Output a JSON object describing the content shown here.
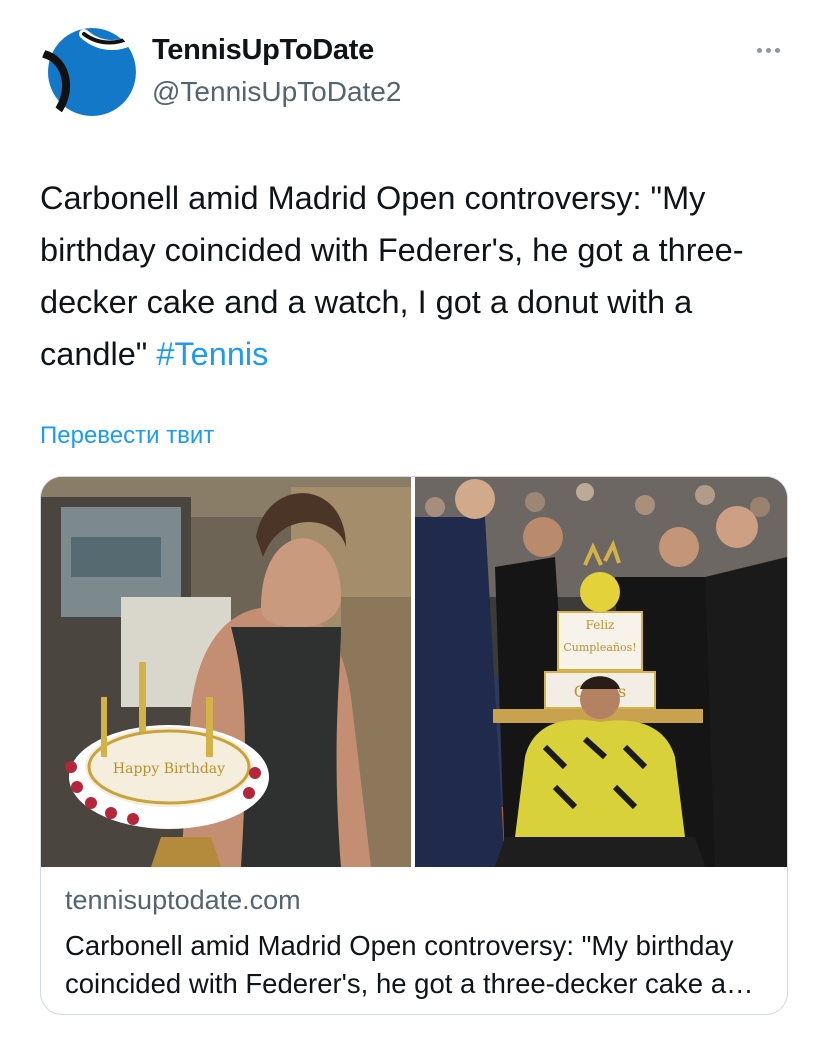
{
  "tweet": {
    "author": {
      "display_name": "TennisUpToDate",
      "handle": "@TennisUpToDate2",
      "avatar_icon": "tennis-ball-logo-icon"
    },
    "more_icon": "more-horizontal-icon",
    "text_main": "Carbonell amid Madrid Open controversy: \"My birthday coincided with Federer's, he got a three-decker cake and a watch, I got a donut with a candle\"",
    "hashtag": "#Tennis",
    "translate_label": "Перевести твит"
  },
  "link_card": {
    "domain": "tennisuptodate.com",
    "title": "Carbonell amid Madrid Open controversy: \"My birthday coincided with Federer's, he got a three-decker cake and a watch, I got a donut with a candle\"",
    "images": [
      {
        "name": "birthday-cake-photo-left",
        "cake_text": "Happy Birthday"
      },
      {
        "name": "birthday-cake-photo-right",
        "cake_text_top": "Feliz",
        "cake_text_mid": "Cumpleaños!",
        "cake_text_bottom": "Carlos"
      }
    ]
  },
  "colors": {
    "accent": "#1d9bf0",
    "text": "#0f1419",
    "secondary_text": "#536471",
    "border": "#cfd9de",
    "avatar_blue": "#1478c8"
  }
}
